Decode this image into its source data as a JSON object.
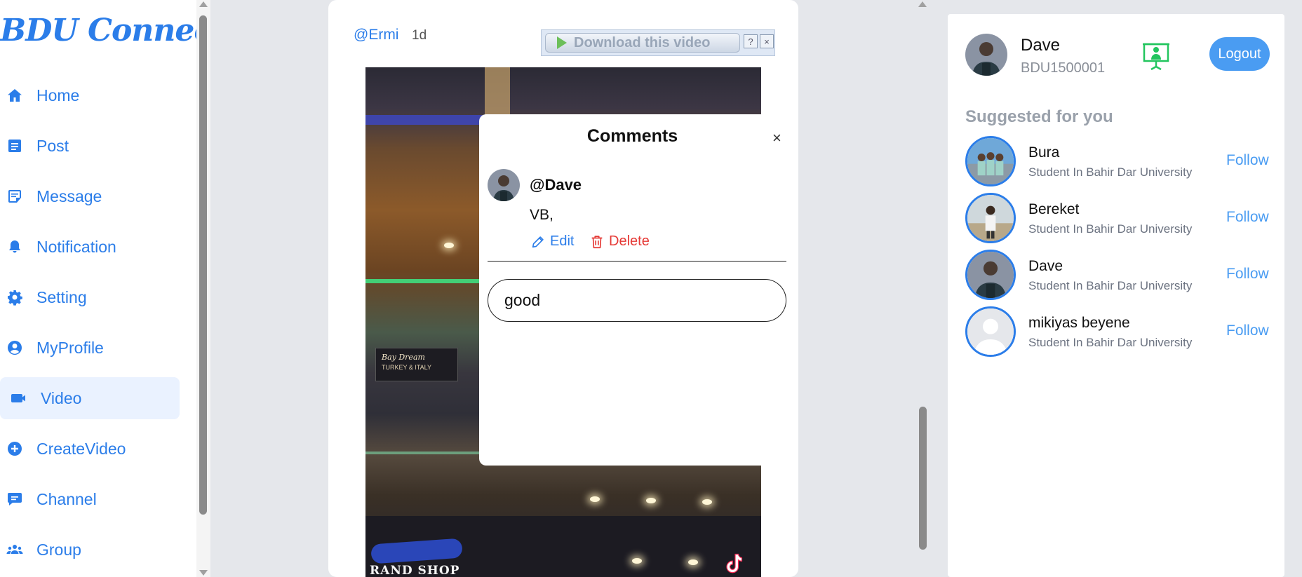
{
  "app": {
    "logo": "BDU Connect"
  },
  "colors": {
    "accent": "#2b7de9",
    "follow": "#4a9cf2",
    "delete": "#e53935",
    "active_nav_bg": "#eaf2ff",
    "presence_icon": "#22c55e"
  },
  "sidebar": {
    "items": [
      {
        "label": "Home",
        "icon": "home-icon"
      },
      {
        "label": "Post",
        "icon": "post-icon"
      },
      {
        "label": "Message",
        "icon": "message-icon"
      },
      {
        "label": "Notification",
        "icon": "bell-icon"
      },
      {
        "label": "Setting",
        "icon": "gear-icon"
      },
      {
        "label": "MyProfile",
        "icon": "user-circle-icon"
      },
      {
        "label": "Video",
        "icon": "video-camera-icon",
        "active": true
      },
      {
        "label": "CreateVideo",
        "icon": "plus-circle-icon"
      },
      {
        "label": "Channel",
        "icon": "chat-bubble-icon"
      },
      {
        "label": "Group",
        "icon": "users-icon"
      }
    ]
  },
  "post": {
    "user": "@Ermi",
    "time": "1d",
    "download_bar": {
      "label": "Download this video",
      "help": "?",
      "close": "×"
    },
    "video_overlay": {
      "brand": "RAND SHOP",
      "sign_line1": "Bay Dream",
      "sign_line2": "TURKEY & ITALY"
    }
  },
  "comments": {
    "title": "Comments",
    "close": "×",
    "items": [
      {
        "user": "@Dave",
        "text": "VB,",
        "edit_label": "Edit",
        "delete_label": "Delete"
      }
    ],
    "input_value": "good"
  },
  "profile": {
    "name": "Dave",
    "id": "BDU1500001",
    "logout_label": "Logout"
  },
  "suggestions": {
    "title": "Suggested for you",
    "items": [
      {
        "name": "Bura",
        "subtitle": "Student In Bahir Dar University",
        "action": "Follow"
      },
      {
        "name": "Bereket",
        "subtitle": "Student In Bahir Dar University",
        "action": "Follow"
      },
      {
        "name": "Dave",
        "subtitle": "Student In Bahir Dar University",
        "action": "Follow"
      },
      {
        "name": "mikiyas beyene",
        "subtitle": "Student In Bahir Dar University",
        "action": "Follow"
      }
    ]
  }
}
